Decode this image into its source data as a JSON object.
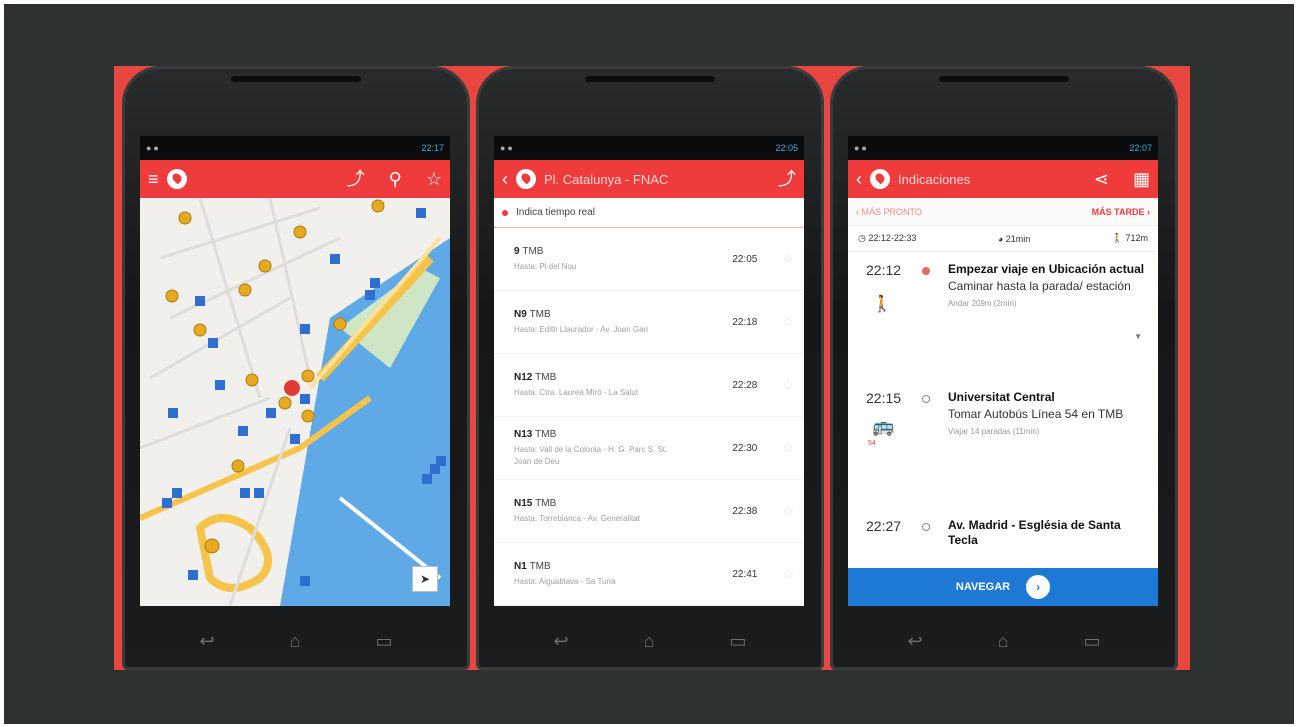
{
  "phone1": {
    "status_time": "22:17",
    "locate_icon": "navigation-arrow-icon"
  },
  "phone2": {
    "status_time": "22:05",
    "title": "Pl. Catalunya - FNAC",
    "realtime_label": "Indica tiempo real",
    "rows": [
      {
        "line": "9",
        "operator": "TMB",
        "dest": "Hasta: Pl del Nou",
        "time": "22:05"
      },
      {
        "line": "N9",
        "operator": "TMB",
        "dest": "Hasta: Edith Llaurador - Av. Joan Gari",
        "time": "22:18"
      },
      {
        "line": "N12",
        "operator": "TMB",
        "dest": "Hasta: Ctra. Laureà Miró - La Salut",
        "time": "22:28"
      },
      {
        "line": "N13",
        "operator": "TMB",
        "dest": "Hasta: Vall de la Colonia - H. G. Parc S. St. Joan de Deu",
        "time": "22:30"
      },
      {
        "line": "N15",
        "operator": "TMB",
        "dest": "Hasta: Torreblanca - Av. Generalitat",
        "time": "22:38"
      },
      {
        "line": "N1",
        "operator": "TMB",
        "dest": "Hasta: Aiguablava - Sa Tuna",
        "time": "22:41"
      }
    ]
  },
  "phone3": {
    "status_time": "22:07",
    "title": "Indicaciones",
    "prev_tab": "MÁS PRONTO",
    "next_tab": "MÁS TARDE",
    "timespan": "22:12-22:33",
    "duration": "21min",
    "walk_distance": "712m",
    "steps": [
      {
        "time": "22:12",
        "name": "Empezar viaje en Ubicación actual",
        "desc": "Caminar hasta la parada/ estación",
        "small": "Andar 209m (2min)"
      },
      {
        "time": "22:15",
        "name": "Universitat Central",
        "desc": "Tomar Autobús Línea 54 en TMB",
        "small": "Viajar 14 paradas (11min)",
        "badge": "54"
      },
      {
        "time": "22:27",
        "name": "Av. Madrid - Església de Santa Tecla",
        "desc": "",
        "small": ""
      }
    ],
    "nav_label": "NAVEGAR"
  }
}
